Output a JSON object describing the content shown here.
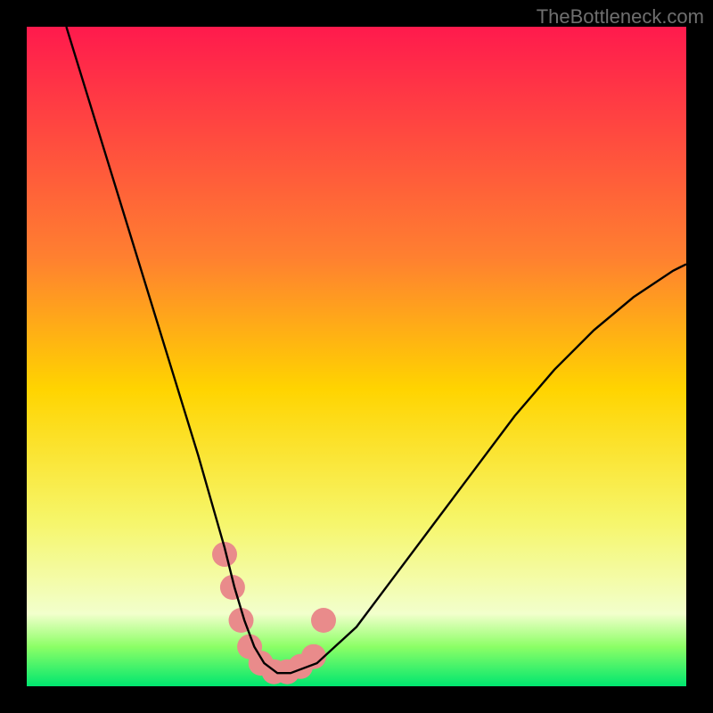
{
  "watermark": "TheBottleneck.com",
  "chart_data": {
    "type": "line",
    "title": "",
    "xlabel": "",
    "ylabel": "",
    "xlim": [
      0,
      100
    ],
    "ylim": [
      0,
      100
    ],
    "background_gradient": {
      "stops": [
        {
          "offset": 0,
          "color": "#ff1a4d"
        },
        {
          "offset": 35,
          "color": "#ff8030"
        },
        {
          "offset": 55,
          "color": "#ffd400"
        },
        {
          "offset": 75,
          "color": "#f6f66a"
        },
        {
          "offset": 89,
          "color": "#f2ffcc"
        },
        {
          "offset": 94,
          "color": "#8cff66"
        },
        {
          "offset": 100,
          "color": "#00e66f"
        }
      ]
    },
    "series": [
      {
        "name": "bottleneck-curve",
        "color": "#000000",
        "x": [
          6,
          10,
          14,
          18,
          22,
          26,
          28,
          30,
          31.5,
          33,
          34.5,
          36,
          38,
          40,
          44,
          50,
          56,
          62,
          68,
          74,
          80,
          86,
          92,
          98,
          100
        ],
        "y": [
          100,
          87,
          74,
          61,
          48,
          35,
          28,
          21,
          15,
          10,
          6,
          3.5,
          2,
          2,
          3.5,
          9,
          17,
          25,
          33,
          41,
          48,
          54,
          59,
          63,
          64
        ]
      }
    ],
    "markers": {
      "name": "highlight-points",
      "color": "#e98b8b",
      "size": 14,
      "x": [
        30.0,
        31.2,
        32.5,
        33.8,
        35.5,
        37.5,
        39.5,
        41.5,
        43.5,
        45.0
      ],
      "y": [
        20.0,
        15.0,
        10.0,
        6.0,
        3.5,
        2.2,
        2.2,
        3.0,
        4.5,
        10.0
      ]
    }
  }
}
